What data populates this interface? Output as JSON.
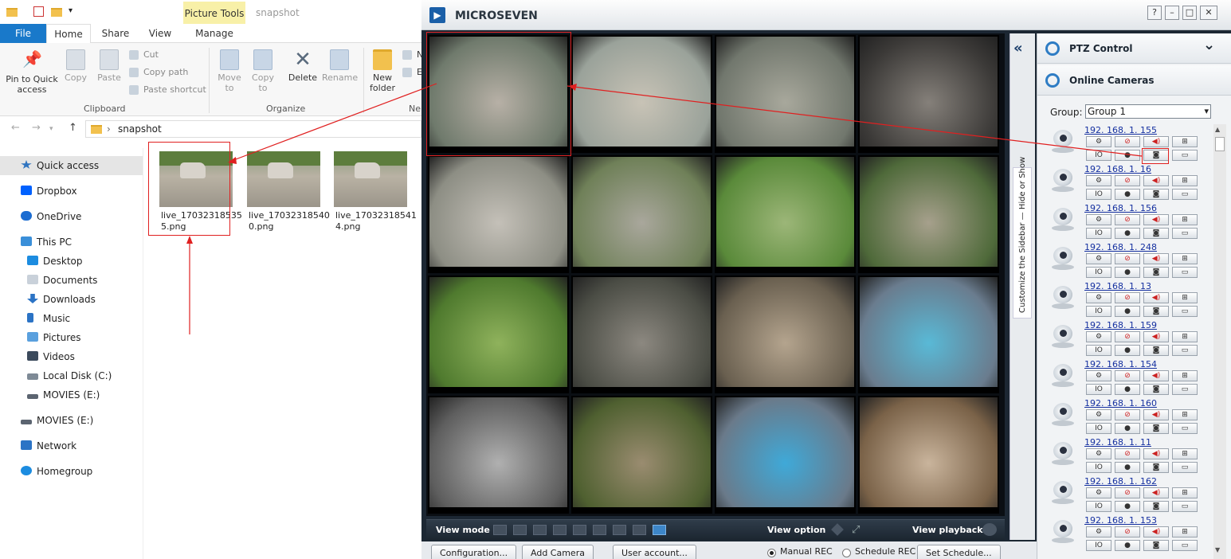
{
  "explorer": {
    "picture_tools": "Picture Tools",
    "folder_title": "snapshot",
    "tabs": [
      "File",
      "Home",
      "Share",
      "View",
      "Manage"
    ],
    "clipboard": {
      "pin": "Pin to Quick access",
      "copy": "Copy",
      "paste": "Paste",
      "cut": "Cut",
      "copy_path": "Copy path",
      "paste_shortcut": "Paste shortcut",
      "group": "Clipboard"
    },
    "organize": {
      "move_to": "Move to",
      "copy_to": "Copy to",
      "delete": "Delete",
      "rename": "Rename",
      "group": "Organize"
    },
    "new": {
      "new_folder": "New folder",
      "group": "Ne"
    },
    "address": {
      "segment": "snapshot"
    },
    "nav": [
      {
        "label": "Quick access",
        "icon": "star-icon"
      },
      {
        "label": "Dropbox",
        "icon": "dropbox-icon"
      },
      {
        "label": "OneDrive",
        "icon": "cloud-icon"
      },
      {
        "label": "This PC",
        "icon": "computer-icon"
      },
      {
        "label": "Desktop",
        "icon": "desktop-icon"
      },
      {
        "label": "Documents",
        "icon": "documents-icon"
      },
      {
        "label": "Downloads",
        "icon": "download-icon"
      },
      {
        "label": "Music",
        "icon": "music-icon"
      },
      {
        "label": "Pictures",
        "icon": "pictures-icon"
      },
      {
        "label": "Videos",
        "icon": "videos-icon"
      },
      {
        "label": "Local Disk (C:)",
        "icon": "disk-icon"
      },
      {
        "label": "MOVIES (E:)",
        "icon": "drive-icon"
      },
      {
        "label": "MOVIES (E:)",
        "icon": "drive-icon"
      },
      {
        "label": "Network",
        "icon": "network-icon"
      },
      {
        "label": "Homegroup",
        "icon": "homegroup-icon"
      }
    ],
    "files": [
      {
        "name": "live_17032318535 5.png"
      },
      {
        "name": "live_17032318540 0.png"
      },
      {
        "name": "live_17032318541 4.png"
      }
    ]
  },
  "app": {
    "title": "MICROSEVEN",
    "window_buttons": [
      "?",
      "–",
      "□",
      "✕"
    ],
    "view_mode": "View mode",
    "view_option": "View option",
    "view_playback": "View playback",
    "sidebar_toggle": "Customize the Sidebar — Hide or Show",
    "ptz_control": "PTZ Control",
    "online_cameras": "Online Cameras",
    "group_label": "Group:",
    "group_value": "Group 1",
    "bottom": {
      "configuration": "Configuration...",
      "add_camera": "Add Camera",
      "user_account": "User account...",
      "manual_rec": "Manual REC",
      "schedule_rec": "Schedule REC",
      "set_schedule": "Set Schedule..."
    },
    "cameras": [
      {
        "ip": "192. 168. 1. 155"
      },
      {
        "ip": "192. 168. 1. 16"
      },
      {
        "ip": "192. 168. 1. 156"
      },
      {
        "ip": "192. 168. 1. 248"
      },
      {
        "ip": "192. 168. 1. 13"
      },
      {
        "ip": "192. 168. 1. 159"
      },
      {
        "ip": "192. 168. 1. 154"
      },
      {
        "ip": "192. 168. 1. 160"
      },
      {
        "ip": "192. 168. 1. 11"
      },
      {
        "ip": "192. 168. 1. 162"
      },
      {
        "ip": "192. 168. 1. 153"
      }
    ]
  }
}
